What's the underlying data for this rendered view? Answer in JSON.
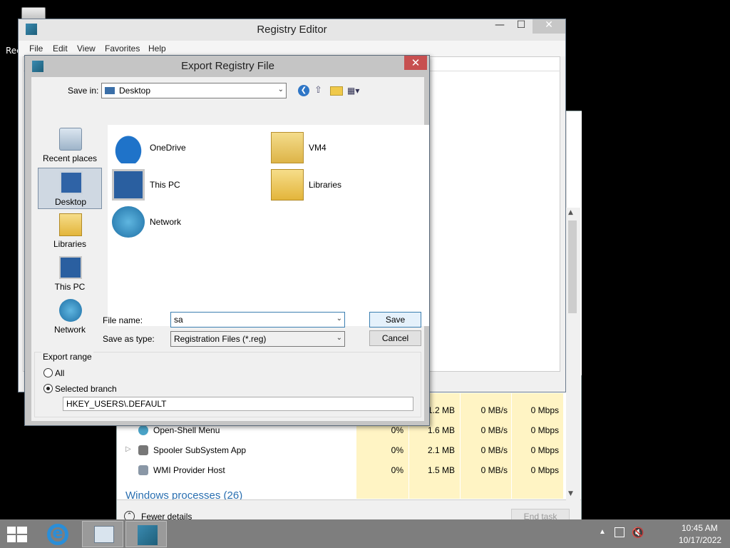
{
  "desktop": {
    "recycle_label": "Rec"
  },
  "regedit": {
    "title": "Registry Editor",
    "menu": [
      "File",
      "Edit",
      "View",
      "Favorites",
      "Help"
    ],
    "minimize": "—",
    "maximize": "☐",
    "close": "✕"
  },
  "dialog": {
    "title": "Export Registry File",
    "close": "✕",
    "save_in_label": "Save in:",
    "save_in_value": "Desktop",
    "places": [
      "Recent places",
      "Desktop",
      "Libraries",
      "This PC",
      "Network"
    ],
    "files": [
      "OneDrive",
      "VM4",
      "This PC",
      "Libraries",
      "Network"
    ],
    "file_name_label": "File name:",
    "file_name_value": "sa",
    "save_type_label": "Save as type:",
    "save_type_value": "Registration Files (*.reg)",
    "save_button": "Save",
    "cancel_button": "Cancel",
    "export_range_label": "Export range",
    "radio_all": "All",
    "radio_selected": "Selected branch",
    "branch_value": "HKEY_USERS\\.DEFAULT"
  },
  "taskmgr": {
    "partial_row": {
      "memory": "1.2 MB",
      "disk": "0 MB/s",
      "network": "0 Mbps"
    },
    "rows": [
      {
        "name": "Open-Shell Menu",
        "cpu": "0%",
        "memory": "1.6 MB",
        "disk": "0 MB/s",
        "network": "0 Mbps"
      },
      {
        "name": "Spooler SubSystem App",
        "cpu": "0%",
        "memory": "2.1 MB",
        "disk": "0 MB/s",
        "network": "0 Mbps"
      },
      {
        "name": "WMI Provider Host",
        "cpu": "0%",
        "memory": "1.5 MB",
        "disk": "0 MB/s",
        "network": "0 Mbps"
      }
    ],
    "group_header": "Windows processes (26)",
    "fewer_details": "Fewer details",
    "end_task": "End task"
  },
  "taskbar": {
    "time": "10:45 AM",
    "date": "10/17/2022"
  },
  "colors": {
    "accent": "#3c7fb1",
    "close_red": "#c75050",
    "highlight": "#fff4c4"
  }
}
